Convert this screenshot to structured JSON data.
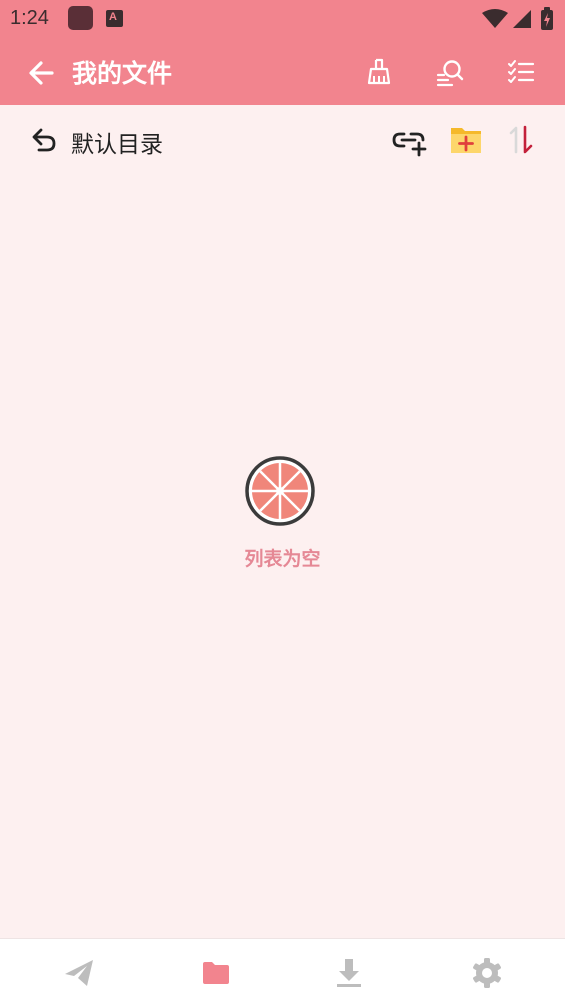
{
  "status_bar": {
    "time": "1:24",
    "a_badge": "A"
  },
  "app_bar": {
    "title": "我的文件",
    "tools": [
      "broom-icon",
      "search-icon",
      "checklist-icon"
    ]
  },
  "directory": {
    "title": "默认目录",
    "tools": [
      "link-add-icon",
      "folder-add-icon",
      "sort-icon"
    ]
  },
  "empty_state": {
    "text": "列表为空",
    "icon": "grapefruit-icon"
  },
  "bottom_nav": {
    "active_index": 1,
    "items": [
      "send-icon",
      "folder-icon",
      "download-icon",
      "settings-icon"
    ]
  },
  "colors": {
    "primary": "#f2848e",
    "background": "#fdf0f0",
    "nav_inactive": "#bdbdbd",
    "accent_text": "#e58895"
  }
}
